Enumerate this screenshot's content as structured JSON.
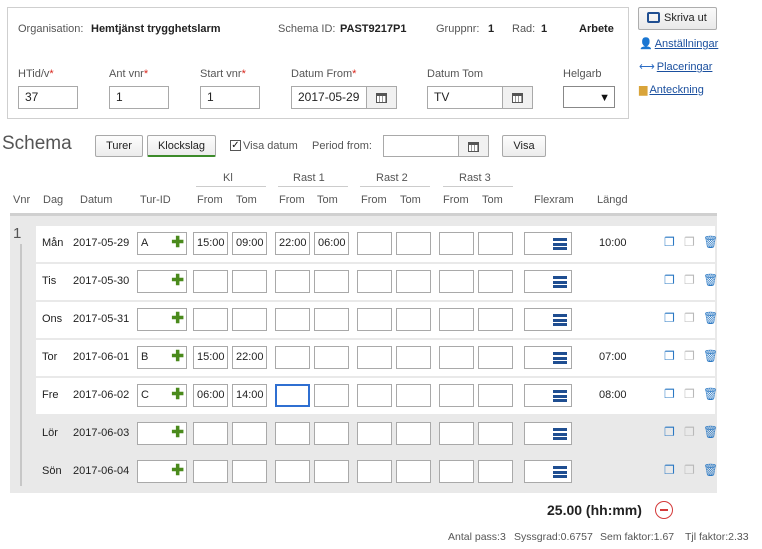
{
  "header": {
    "organisation_label": "Organisation:",
    "organisation_value": "Hemtjänst trygghetslarm",
    "schema_id_label": "Schema ID:",
    "schema_id_value": "PAST9217P1",
    "gruppnr_label": "Gruppnr:",
    "gruppnr_value": "1",
    "rad_label": "Rad:",
    "rad_value": "1",
    "status": "Arbete",
    "required_mark": "*",
    "htid_label": "HTid/v",
    "htid_value": "37",
    "antvnr_label": "Ant vnr",
    "antvnr_value": "1",
    "startvnr_label": "Start vnr",
    "startvnr_value": "1",
    "datumfrom_label": "Datum From",
    "datumfrom_value": "2017-05-29",
    "datumtom_label": "Datum Tom",
    "datumtom_value": "TV",
    "helgarb_label": "Helgarb",
    "helgarb_value": ""
  },
  "side": {
    "print_label": "Skriva ut",
    "links": [
      "Anställningar",
      "Placeringar",
      "Anteckning"
    ]
  },
  "schema": {
    "title": "Schema",
    "turer_label": "Turer",
    "klockslag_label": "Klockslag",
    "visa_datum_label": "Visa datum",
    "visa_datum_checked": "✓",
    "period_from_label": "Period from:",
    "period_from_value": "",
    "visa_label": "Visa"
  },
  "columns": {
    "vnr": "Vnr",
    "dag": "Dag",
    "datum": "Datum",
    "turid": "Tur-ID",
    "kl": "Kl",
    "rast1": "Rast 1",
    "rast2": "Rast 2",
    "rast3": "Rast 3",
    "from": "From",
    "tom": "Tom",
    "flexram": "Flexram",
    "langd": "Längd"
  },
  "week": "1",
  "rows": [
    {
      "dag": "Mån",
      "datum": "2017-05-29",
      "tur": "A",
      "kl_from": "15:00",
      "kl_tom": "09:00",
      "r1_from": "22:00",
      "r1_tom": "06:00",
      "langd": "10:00"
    },
    {
      "dag": "Tis",
      "datum": "2017-05-30",
      "tur": "",
      "kl_from": "",
      "kl_tom": "",
      "r1_from": "",
      "r1_tom": "",
      "langd": ""
    },
    {
      "dag": "Ons",
      "datum": "2017-05-31",
      "tur": "",
      "kl_from": "",
      "kl_tom": "",
      "r1_from": "",
      "r1_tom": "",
      "langd": ""
    },
    {
      "dag": "Tor",
      "datum": "2017-06-01",
      "tur": "B",
      "kl_from": "15:00",
      "kl_tom": "22:00",
      "r1_from": "",
      "r1_tom": "",
      "langd": "07:00"
    },
    {
      "dag": "Fre",
      "datum": "2017-06-02",
      "tur": "C",
      "kl_from": "06:00",
      "kl_tom": "14:00",
      "r1_from": "",
      "r1_tom": "",
      "langd": "08:00"
    },
    {
      "dag": "Lör",
      "datum": "2017-06-03",
      "tur": "",
      "kl_from": "",
      "kl_tom": "",
      "r1_from": "",
      "r1_tom": "",
      "langd": ""
    },
    {
      "dag": "Sön",
      "datum": "2017-06-04",
      "tur": "",
      "kl_from": "",
      "kl_tom": "",
      "r1_from": "",
      "r1_tom": "",
      "langd": ""
    }
  ],
  "footer": {
    "total": "25.00 (hh:mm)",
    "stats": [
      "Antal pass:3",
      "Syssgrad:0.6757",
      "Sem faktor:1.67",
      "Tjl faktor:2.33"
    ]
  },
  "colors": {
    "accent": "#1f4e91",
    "plus": "#4a8a1c",
    "required": "#d9261c",
    "remove": "#d43a3a"
  }
}
